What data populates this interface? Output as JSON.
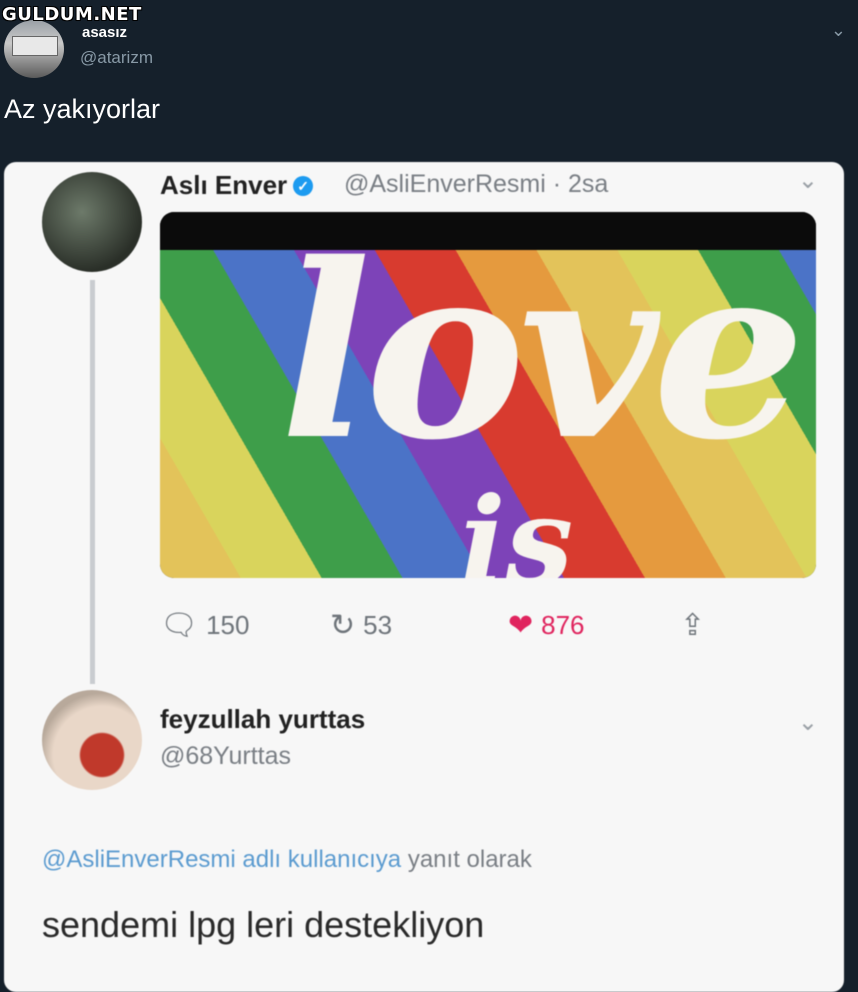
{
  "watermark": "GULDUM.NET",
  "outer_tweet": {
    "name": "asasız",
    "handle": "@atarizm",
    "text": "Az yakıyorlar",
    "menu_icon": "chevron-down-icon"
  },
  "quoted_tweet": {
    "name": "Aslı Enver",
    "verified_icon": "verified-badge-icon",
    "handle_time": "@AsliEnverResmi · 2sa",
    "media_text_main": "love",
    "media_text_sub": "is",
    "actions": {
      "replies": "150",
      "retweets": "53",
      "likes": "876"
    },
    "colors": {
      "like": "#e0245e",
      "verified": "#1d9bf0"
    }
  },
  "reply_tweet": {
    "name": "feyzullah yurttas",
    "handle": "@68Yurttas",
    "reply_mention": "@AsliEnverResmi adlı kullanıcıya",
    "reply_suffix": "yanıt olarak",
    "text": "sendemi lpg leri destekliyon"
  }
}
